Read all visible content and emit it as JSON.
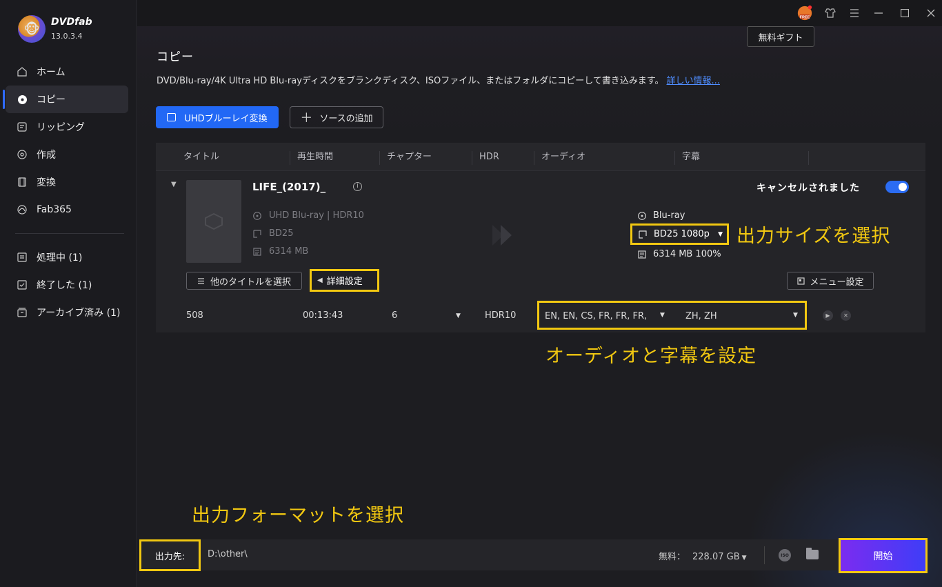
{
  "app": {
    "name": "DVDfab",
    "version": "13.0.3.4"
  },
  "sidebar": {
    "items": [
      {
        "label": "ホーム",
        "icon": "home-icon"
      },
      {
        "label": "コピー",
        "icon": "disc-copy-icon",
        "active": true
      },
      {
        "label": "リッピング",
        "icon": "ripper-icon"
      },
      {
        "label": "作成",
        "icon": "creator-icon"
      },
      {
        "label": "変換",
        "icon": "converter-icon"
      },
      {
        "label": "Fab365",
        "icon": "fab365-icon"
      }
    ],
    "queue": [
      {
        "label": "処理中 (1)",
        "icon": "processing-icon"
      },
      {
        "label": "終了した (1)",
        "icon": "finished-icon"
      },
      {
        "label": "アーカイブ済み (1)",
        "icon": "archive-icon"
      }
    ]
  },
  "topbar": {
    "gift_tooltip": "無料ギフト",
    "free_badge": "FREE"
  },
  "page": {
    "title": "コピー",
    "description": "DVD/Blu-ray/4K Ultra HD Blu-rayディスクをブランクディスク、ISOファイル、またはフォルダにコピーして書き込みます。",
    "more_link": "詳しい情報...",
    "uhd_button": "UHDブルーレイ変換",
    "add_source_button": "ソースの追加"
  },
  "table": {
    "headers": [
      "タイトル",
      "再生時間",
      "チャプター",
      "HDR",
      "オーディオ",
      "字幕"
    ],
    "item": {
      "title": "LIFE_(2017)_",
      "source_type": "UHD Blu-ray | HDR10",
      "source_disc": "BD25",
      "source_size": "6314 MB",
      "status": "キャンセルされました",
      "output_type": "Blu-ray",
      "output_size_option": "BD25 1080p",
      "output_size": "6314 MB 100%",
      "other_titles_button": "他のタイトルを選択",
      "advanced_button": "詳細設定",
      "menu_button": "メニュー設定",
      "title_id": "508",
      "duration": "00:13:43",
      "chapters": "6",
      "hdr": "HDR10",
      "audio": "EN, EN, CS, FR, FR, FR,",
      "subtitles": "ZH, ZH"
    }
  },
  "annotations": {
    "size": "出力サイズを選択",
    "audio": "オーディオと字幕を設定",
    "format": "出力フォーマットを選択"
  },
  "footer": {
    "output_label": "出力先:",
    "output_path": "D:\\other\\",
    "free_label": "無料：",
    "free_value": "228.07 GB",
    "start_button": "開始",
    "iso_label": "ISO"
  },
  "colors": {
    "accent": "#2268f5",
    "highlight": "#f2c811",
    "start_gradient": "#7b2cf0"
  }
}
